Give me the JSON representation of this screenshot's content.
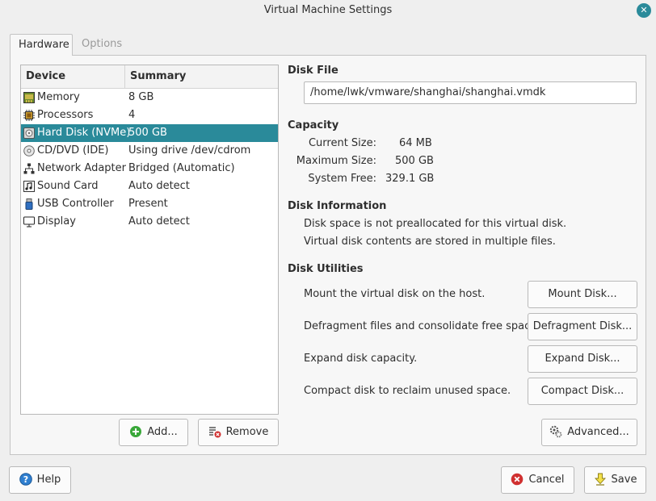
{
  "window": {
    "title": "Virtual Machine Settings",
    "close_glyph": "✕"
  },
  "tabs": [
    {
      "label": "Hardware",
      "active": true
    },
    {
      "label": "Options",
      "active": false
    }
  ],
  "device_list": {
    "headers": {
      "device": "Device",
      "summary": "Summary"
    },
    "rows": [
      {
        "device": "Memory",
        "summary": "8 GB",
        "icon": "memory-icon"
      },
      {
        "device": "Processors",
        "summary": "4",
        "icon": "processor-icon"
      },
      {
        "device": "Hard Disk (NVMe)",
        "summary": "500 GB",
        "icon": "hard-disk-icon",
        "selected": true
      },
      {
        "device": "CD/DVD (IDE)",
        "summary": "Using drive /dev/cdrom",
        "icon": "cd-dvd-icon"
      },
      {
        "device": "Network Adapter",
        "summary": "Bridged (Automatic)",
        "icon": "network-icon"
      },
      {
        "device": "Sound Card",
        "summary": "Auto detect",
        "icon": "sound-icon"
      },
      {
        "device": "USB Controller",
        "summary": "Present",
        "icon": "usb-icon"
      },
      {
        "device": "Display",
        "summary": "Auto detect",
        "icon": "display-icon"
      }
    ],
    "add_label": "Add...",
    "remove_label": "Remove"
  },
  "disk_file": {
    "title": "Disk File",
    "path": "/home/lwk/vmware/shanghai/shanghai.vmdk"
  },
  "capacity": {
    "title": "Capacity",
    "current_label": "Current Size:",
    "current_value": "64 MB",
    "max_label": "Maximum Size:",
    "max_value": "500 GB",
    "free_label": "System Free:",
    "free_value": "329.1 GB"
  },
  "disk_information": {
    "title": "Disk Information",
    "line1": "Disk space is not preallocated for this virtual disk.",
    "line2": "Virtual disk contents are stored in multiple files."
  },
  "disk_utilities": {
    "title": "Disk Utilities",
    "mount_text": "Mount the virtual disk on the host.",
    "mount_label": "Mount Disk...",
    "defrag_text": "Defragment files and consolidate free space.",
    "defrag_label": "Defragment Disk...",
    "expand_text": "Expand disk capacity.",
    "expand_label": "Expand Disk...",
    "compact_text": "Compact disk to reclaim unused space.",
    "compact_label": "Compact Disk..."
  },
  "advanced_label": "Advanced...",
  "footer": {
    "help_label": "Help",
    "cancel_label": "Cancel",
    "save_label": "Save"
  },
  "colors": {
    "accent": "#2a8a9a",
    "add_green": "#3aa83a",
    "cancel_red": "#d03030",
    "help_blue": "#2f7fd0"
  }
}
